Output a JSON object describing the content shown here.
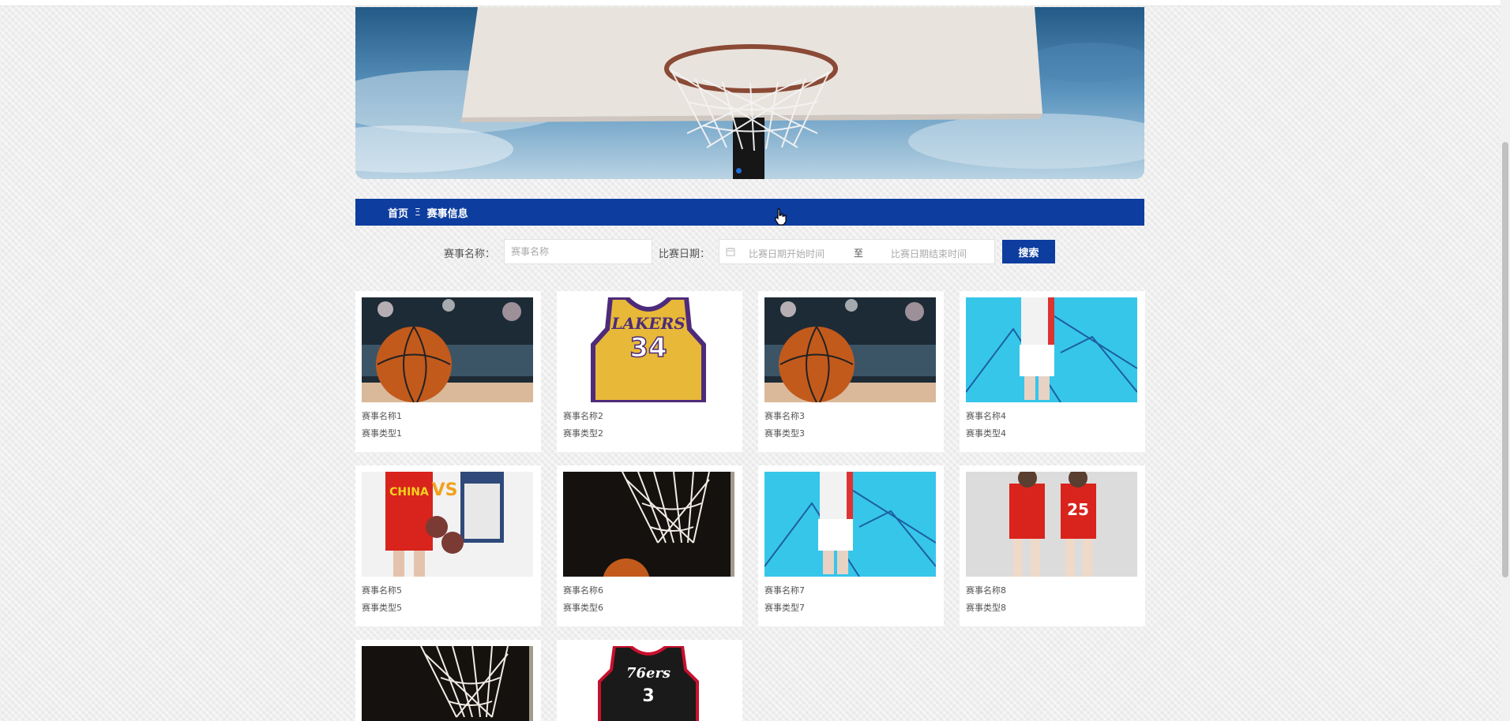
{
  "breadcrumb": {
    "home": "首页",
    "separator": "Ξ",
    "current": "赛事信息"
  },
  "search": {
    "name_label": "赛事名称：",
    "name_placeholder": "赛事名称",
    "date_label": "比赛日期：",
    "date_start_placeholder": "比赛日期开始时间",
    "date_to": "至",
    "date_end_placeholder": "比赛日期结束时间",
    "button_label": "搜索"
  },
  "events": [
    {
      "name": "赛事名称1",
      "type": "赛事类型1",
      "image": "basketball-arena"
    },
    {
      "name": "赛事名称2",
      "type": "赛事类型2",
      "image": "lakers-jersey"
    },
    {
      "name": "赛事名称3",
      "type": "赛事类型3",
      "image": "basketball-arena"
    },
    {
      "name": "赛事名称4",
      "type": "赛事类型4",
      "image": "player-cyan-court"
    },
    {
      "name": "赛事名称5",
      "type": "赛事类型5",
      "image": "china-vs-players"
    },
    {
      "name": "赛事名称6",
      "type": "赛事类型6",
      "image": "hoop-dark"
    },
    {
      "name": "赛事名称7",
      "type": "赛事类型7",
      "image": "player-cyan-court"
    },
    {
      "name": "赛事名称8",
      "type": "赛事类型8",
      "image": "kids-red-jerseys"
    },
    {
      "name": "",
      "type": "",
      "image": "hoop-dark"
    },
    {
      "name": "",
      "type": "",
      "image": "sixers-jersey"
    }
  ],
  "jersey_texts": {
    "lakers": "LAKERS",
    "lakers_number": "34",
    "china": "CHINA",
    "vs": "VS",
    "sixers": "76ers",
    "sixers_number": "3",
    "kids_number": "25"
  },
  "colors": {
    "nav": "#0d3d9f",
    "button": "#0d3d9f",
    "background": "#efefef"
  }
}
